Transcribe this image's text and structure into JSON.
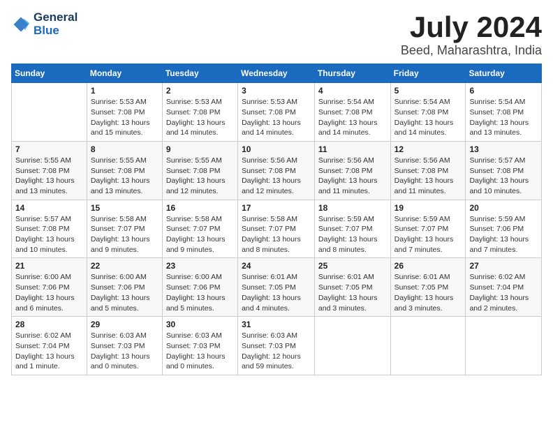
{
  "header": {
    "logo_line1": "General",
    "logo_line2": "Blue",
    "month": "July 2024",
    "location": "Beed, Maharashtra, India"
  },
  "weekdays": [
    "Sunday",
    "Monday",
    "Tuesday",
    "Wednesday",
    "Thursday",
    "Friday",
    "Saturday"
  ],
  "weeks": [
    [
      {
        "day": "",
        "sunrise": "",
        "sunset": "",
        "daylight": ""
      },
      {
        "day": "1",
        "sunrise": "5:53 AM",
        "sunset": "7:08 PM",
        "daylight": "13 hours and 15 minutes."
      },
      {
        "day": "2",
        "sunrise": "5:53 AM",
        "sunset": "7:08 PM",
        "daylight": "13 hours and 14 minutes."
      },
      {
        "day": "3",
        "sunrise": "5:53 AM",
        "sunset": "7:08 PM",
        "daylight": "13 hours and 14 minutes."
      },
      {
        "day": "4",
        "sunrise": "5:54 AM",
        "sunset": "7:08 PM",
        "daylight": "13 hours and 14 minutes."
      },
      {
        "day": "5",
        "sunrise": "5:54 AM",
        "sunset": "7:08 PM",
        "daylight": "13 hours and 14 minutes."
      },
      {
        "day": "6",
        "sunrise": "5:54 AM",
        "sunset": "7:08 PM",
        "daylight": "13 hours and 13 minutes."
      }
    ],
    [
      {
        "day": "7",
        "sunrise": "5:55 AM",
        "sunset": "7:08 PM",
        "daylight": "13 hours and 13 minutes."
      },
      {
        "day": "8",
        "sunrise": "5:55 AM",
        "sunset": "7:08 PM",
        "daylight": "13 hours and 13 minutes."
      },
      {
        "day": "9",
        "sunrise": "5:55 AM",
        "sunset": "7:08 PM",
        "daylight": "13 hours and 12 minutes."
      },
      {
        "day": "10",
        "sunrise": "5:56 AM",
        "sunset": "7:08 PM",
        "daylight": "13 hours and 12 minutes."
      },
      {
        "day": "11",
        "sunrise": "5:56 AM",
        "sunset": "7:08 PM",
        "daylight": "13 hours and 11 minutes."
      },
      {
        "day": "12",
        "sunrise": "5:56 AM",
        "sunset": "7:08 PM",
        "daylight": "13 hours and 11 minutes."
      },
      {
        "day": "13",
        "sunrise": "5:57 AM",
        "sunset": "7:08 PM",
        "daylight": "13 hours and 10 minutes."
      }
    ],
    [
      {
        "day": "14",
        "sunrise": "5:57 AM",
        "sunset": "7:08 PM",
        "daylight": "13 hours and 10 minutes."
      },
      {
        "day": "15",
        "sunrise": "5:58 AM",
        "sunset": "7:07 PM",
        "daylight": "13 hours and 9 minutes."
      },
      {
        "day": "16",
        "sunrise": "5:58 AM",
        "sunset": "7:07 PM",
        "daylight": "13 hours and 9 minutes."
      },
      {
        "day": "17",
        "sunrise": "5:58 AM",
        "sunset": "7:07 PM",
        "daylight": "13 hours and 8 minutes."
      },
      {
        "day": "18",
        "sunrise": "5:59 AM",
        "sunset": "7:07 PM",
        "daylight": "13 hours and 8 minutes."
      },
      {
        "day": "19",
        "sunrise": "5:59 AM",
        "sunset": "7:07 PM",
        "daylight": "13 hours and 7 minutes."
      },
      {
        "day": "20",
        "sunrise": "5:59 AM",
        "sunset": "7:06 PM",
        "daylight": "13 hours and 7 minutes."
      }
    ],
    [
      {
        "day": "21",
        "sunrise": "6:00 AM",
        "sunset": "7:06 PM",
        "daylight": "13 hours and 6 minutes."
      },
      {
        "day": "22",
        "sunrise": "6:00 AM",
        "sunset": "7:06 PM",
        "daylight": "13 hours and 5 minutes."
      },
      {
        "day": "23",
        "sunrise": "6:00 AM",
        "sunset": "7:06 PM",
        "daylight": "13 hours and 5 minutes."
      },
      {
        "day": "24",
        "sunrise": "6:01 AM",
        "sunset": "7:05 PM",
        "daylight": "13 hours and 4 minutes."
      },
      {
        "day": "25",
        "sunrise": "6:01 AM",
        "sunset": "7:05 PM",
        "daylight": "13 hours and 3 minutes."
      },
      {
        "day": "26",
        "sunrise": "6:01 AM",
        "sunset": "7:05 PM",
        "daylight": "13 hours and 3 minutes."
      },
      {
        "day": "27",
        "sunrise": "6:02 AM",
        "sunset": "7:04 PM",
        "daylight": "13 hours and 2 minutes."
      }
    ],
    [
      {
        "day": "28",
        "sunrise": "6:02 AM",
        "sunset": "7:04 PM",
        "daylight": "13 hours and 1 minute."
      },
      {
        "day": "29",
        "sunrise": "6:03 AM",
        "sunset": "7:03 PM",
        "daylight": "13 hours and 0 minutes."
      },
      {
        "day": "30",
        "sunrise": "6:03 AM",
        "sunset": "7:03 PM",
        "daylight": "13 hours and 0 minutes."
      },
      {
        "day": "31",
        "sunrise": "6:03 AM",
        "sunset": "7:03 PM",
        "daylight": "12 hours and 59 minutes."
      },
      {
        "day": "",
        "sunrise": "",
        "sunset": "",
        "daylight": ""
      },
      {
        "day": "",
        "sunrise": "",
        "sunset": "",
        "daylight": ""
      },
      {
        "day": "",
        "sunrise": "",
        "sunset": "",
        "daylight": ""
      }
    ]
  ]
}
